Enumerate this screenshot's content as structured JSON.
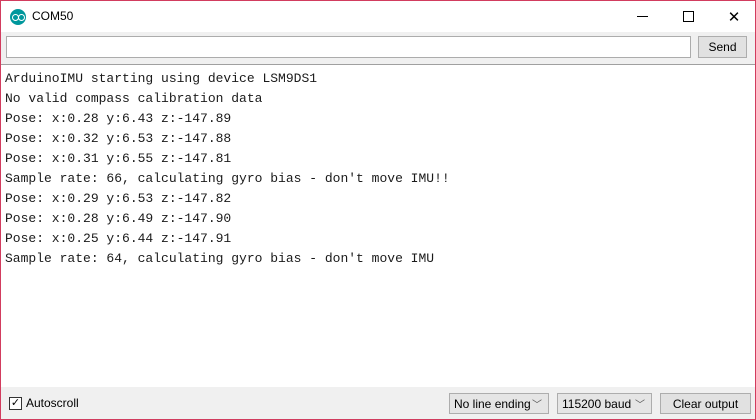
{
  "window": {
    "title": "COM50",
    "icon": "arduino-logo"
  },
  "toolbar": {
    "input_value": "",
    "send_label": "Send"
  },
  "output": {
    "lines": [
      "ArduinoIMU starting using device LSM9DS1",
      "No valid compass calibration data",
      "Pose: x:0.28 y:6.43 z:-147.89",
      "Pose: x:0.32 y:6.53 z:-147.88",
      "Pose: x:0.31 y:6.55 z:-147.81",
      "Sample rate: 66, calculating gyro bias - don't move IMU!!",
      "Pose: x:0.29 y:6.53 z:-147.82",
      "Pose: x:0.28 y:6.49 z:-147.90",
      "Pose: x:0.25 y:6.44 z:-147.91",
      "Sample rate: 64, calculating gyro bias - don't move IMU"
    ]
  },
  "footer": {
    "autoscroll_label": "Autoscroll",
    "autoscroll_checked": true,
    "line_ending": "No line ending",
    "baud": "115200 baud",
    "clear_label": "Clear output"
  }
}
